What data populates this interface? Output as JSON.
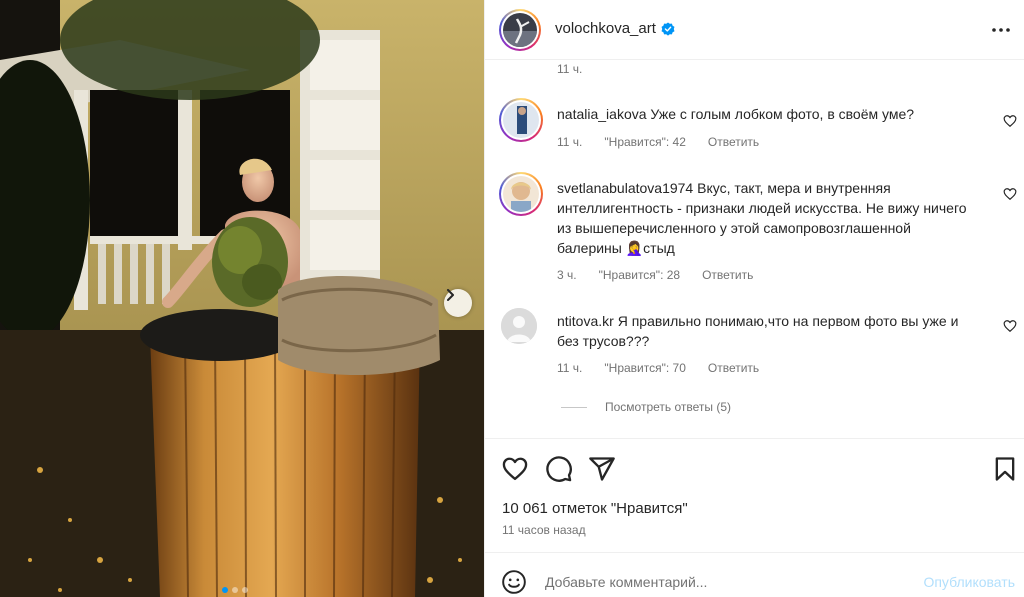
{
  "post": {
    "username": "volochkova_art",
    "verified": true,
    "top_time": "11 ч.",
    "likes_text": "10 061 отметок \"Нравится\"",
    "posted_text": "11 часов назад"
  },
  "comments": [
    {
      "username": "natalia_iakova",
      "text": "Уже с голым лобком фото, в своём уме?",
      "time": "11 ч.",
      "likes": "\"Нравится\": 42",
      "reply": "Ответить"
    },
    {
      "username": "svetlanabulatova1974",
      "text": "Вкус, такт, мера и внутренняя интеллигентность - признаки людей искусства. Не вижу ничего из вышеперечисленного у этой самопровозглашенной балерины 🤦‍♀️стыд",
      "time": "3 ч.",
      "likes": "\"Нравится\": 28",
      "reply": "Ответить"
    },
    {
      "username": "ntitova.kr",
      "text": "Я правильно понимаю,что на первом фото вы уже и без трусов???",
      "time": "11 ч.",
      "likes": "\"Нравится\": 70",
      "reply": "Ответить"
    }
  ],
  "view_replies": "Посмотреть ответы (5)",
  "add_comment": {
    "placeholder": "Добавьте комментарий...",
    "publish": "Опубликовать"
  },
  "icons": [
    "heart-icon",
    "comment-icon",
    "share-icon",
    "bookmark-icon",
    "more-icon",
    "emoji-icon",
    "chevron-right-icon",
    "verified-icon"
  ],
  "colors": {
    "link_blue": "#0095f6",
    "publish_disabled": "#b2dffc",
    "muted_text": "#737373",
    "text": "#262626"
  }
}
